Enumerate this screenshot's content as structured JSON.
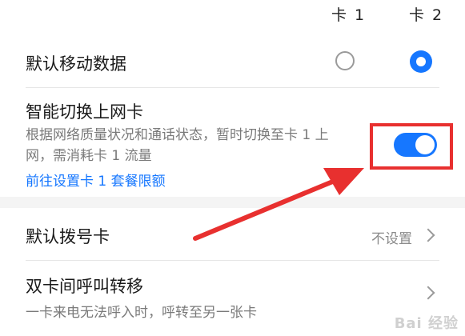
{
  "sim_header": {
    "sim1": "卡 1",
    "sim2": "卡 2"
  },
  "default_mobile_data": {
    "label": "默认移动数据",
    "selected_sim": 2
  },
  "smart_switch": {
    "title": "智能切换上网卡",
    "description": "根据网络质量状况和通话状态，暂时切换至卡 1 上网，需消耗卡 1 流量",
    "link": "前往设置卡 1 套餐限额",
    "enabled": true
  },
  "default_dial": {
    "label": "默认拨号卡",
    "value": "不设置"
  },
  "call_forwarding": {
    "title": "双卡间呼叫转移",
    "description": "一卡来电无法呼入时，呼转至另一张卡"
  },
  "watermark": "Bai 经验",
  "colors": {
    "accent": "#1677ff",
    "annotation": "#e8302f",
    "secondary_text": "#7a7a7a"
  },
  "icons": [
    "chevron-right-icon",
    "radio-icon",
    "toggle-switch"
  ]
}
